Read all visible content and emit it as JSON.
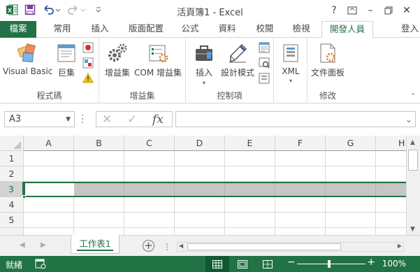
{
  "window": {
    "title": "活頁簿1 - Excel",
    "help": "?",
    "minimize": "–",
    "restore": "❐",
    "close": "✕"
  },
  "ribbon_tabs": {
    "file": "檔案",
    "items": [
      "常用",
      "插入",
      "版面配置",
      "公式",
      "資料",
      "校閱",
      "檢視",
      "開發人員"
    ],
    "active": "開發人員",
    "login": "登入"
  },
  "ribbon": {
    "code_group": {
      "label": "程式碼",
      "visual_basic": "Visual Basic",
      "macros": "巨集"
    },
    "addins_group": {
      "label": "增益集",
      "addins": "增益集",
      "com_addins": "COM 增益集"
    },
    "controls_group": {
      "label": "控制項",
      "insert": "插入",
      "design_mode": "設計模式"
    },
    "xml_group": {
      "xml": "XML"
    },
    "modify_group": {
      "label": "修改",
      "doc_panel": "文件面板"
    }
  },
  "formula_bar": {
    "name_box": "A3",
    "cancel": "✕",
    "enter": "✓",
    "fx": "fx",
    "value": ""
  },
  "grid": {
    "columns": [
      "A",
      "B",
      "C",
      "D",
      "E",
      "F",
      "G",
      "H"
    ],
    "rows": [
      "1",
      "2",
      "3",
      "4",
      "5"
    ],
    "selected_row": "3",
    "active_cell": "A3"
  },
  "sheets": {
    "tabs": [
      "工作表1"
    ],
    "active": "工作表1",
    "add": "+"
  },
  "status_bar": {
    "ready": "就緒",
    "zoom": "100%",
    "zoom_minus": "−",
    "zoom_plus": "+"
  },
  "colors": {
    "accent": "#217346",
    "accent_dark": "#0f5a32",
    "selection_fill": "#c6c6c6"
  }
}
